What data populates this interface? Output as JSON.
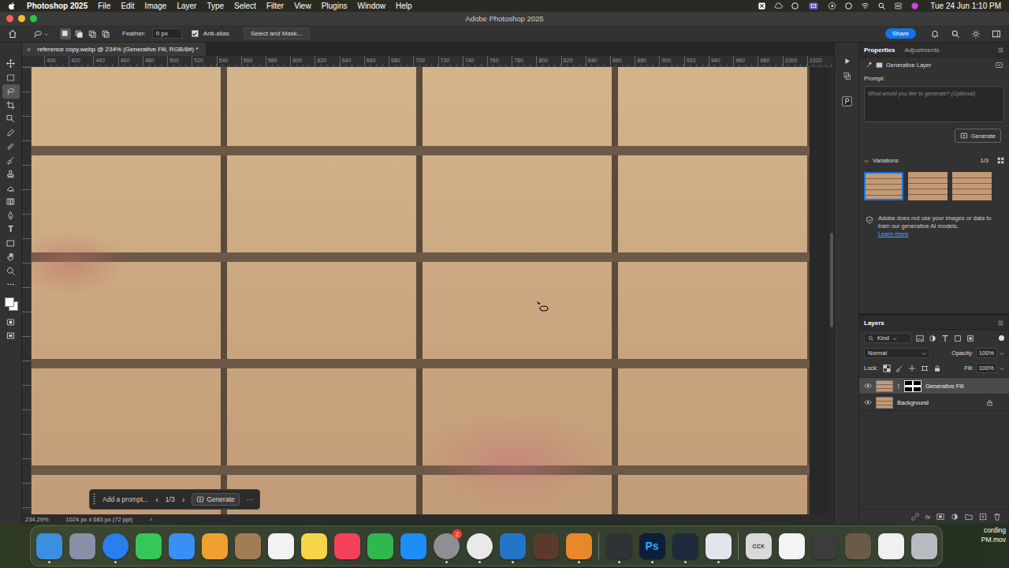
{
  "menubar": {
    "app": "Photoshop 2025",
    "menus": [
      "File",
      "Edit",
      "Image",
      "Layer",
      "Type",
      "Select",
      "Filter",
      "View",
      "Plugins",
      "Window",
      "Help"
    ],
    "clock": "Tue 24 Jun 1:10 PM"
  },
  "window": {
    "title": "Adobe Photoshop 2025"
  },
  "options_bar": {
    "modes": [
      {
        "selected": true
      },
      {
        "selected": false
      },
      {
        "selected": false
      },
      {
        "selected": false
      }
    ],
    "feather_label": "Feather:",
    "feather_value": "0 px",
    "anti_alias": {
      "label": "Anti-alias",
      "checked": true
    },
    "select_mask": "Select and Mask...",
    "share": "Share"
  },
  "tools": [
    {
      "kind": "move",
      "selected": false
    },
    {
      "kind": "marquee",
      "selected": false
    },
    {
      "kind": "lasso",
      "selected": true
    },
    {
      "kind": "crop",
      "selected": false
    },
    {
      "kind": "object",
      "selected": false
    },
    {
      "kind": "eyedropper",
      "selected": false
    },
    {
      "kind": "healing",
      "selected": false
    },
    {
      "kind": "brush",
      "selected": false
    },
    {
      "kind": "stamp",
      "selected": false
    },
    {
      "kind": "eraser",
      "selected": false
    },
    {
      "kind": "gradient",
      "selected": false
    },
    {
      "kind": "pen",
      "selected": false
    },
    {
      "kind": "type",
      "selected": false,
      "glyph": "T"
    },
    {
      "kind": "shape",
      "selected": false
    },
    {
      "kind": "hand",
      "selected": false
    },
    {
      "kind": "zoom",
      "selected": false
    },
    {
      "kind": "more",
      "selected": false
    }
  ],
  "document": {
    "tab_close": "×",
    "tab_title": "reference copy.webp @ 234% (Generative Fill, RGB/8#) *",
    "ruler_ticks": [
      "400",
      "420",
      "440",
      "460",
      "480",
      "500",
      "520",
      "540",
      "560",
      "580",
      "600",
      "620",
      "640",
      "660",
      "680",
      "700",
      "720",
      "740",
      "760",
      "780",
      "800",
      "820",
      "840",
      "860",
      "880",
      "900",
      "920",
      "940",
      "960",
      "980",
      "1000",
      "1020"
    ],
    "zoom": "234.29%",
    "dimensions": "1024 px x 683 px (72 ppi)",
    "status_arrow": "›"
  },
  "taskbar": {
    "prompt_placeholder": "Add a prompt...",
    "prev": "‹",
    "page": "1/3",
    "next": "›",
    "generate": "Generate",
    "more": "···"
  },
  "properties": {
    "tabs": [
      {
        "label": "Properties",
        "selected": true
      },
      {
        "label": "Adjustments",
        "selected": false
      }
    ],
    "layer_type": "Generative Layer",
    "prompt_label": "Prompt:",
    "prompt_placeholder": "What would you like to generate? (Optional)",
    "generate": "Generate",
    "variations": {
      "label": "Variations",
      "expanded": true,
      "page": "1/3",
      "thumbs": [
        {
          "selected": true
        },
        {
          "selected": false
        },
        {
          "selected": false
        }
      ]
    },
    "notice": "Adobe does not use your images or data to train our generative AI models.",
    "learn_more": "Learn more"
  },
  "layers_panel": {
    "title": "Layers",
    "filter": "Kind",
    "blend": "Normal",
    "opacity_label": "Opacity:",
    "opacity": "100%",
    "lock_label": "Lock:",
    "fill_label": "Fill:",
    "fill": "100%",
    "layers": [
      {
        "name": "Generative Fill",
        "kind": "generative",
        "visible": true,
        "selected": true,
        "locked": false
      },
      {
        "name": "Background",
        "kind": "background",
        "visible": true,
        "selected": false,
        "locked": true
      }
    ],
    "fx": "fx"
  },
  "dock": [
    {
      "name": "finder",
      "color": "#3b8fe0",
      "running": true
    },
    {
      "name": "launchpad",
      "color": "#8a8fa8",
      "running": false
    },
    {
      "name": "safari",
      "color": "#2a7ef0",
      "running": true
    },
    {
      "name": "messages",
      "color": "#35c759",
      "running": false
    },
    {
      "name": "mail",
      "color": "#3a8ff5",
      "running": false
    },
    {
      "name": "photos",
      "color": "#f0a030",
      "running": false
    },
    {
      "name": "contacts",
      "color": "#a27c55",
      "running": false
    },
    {
      "name": "reminders",
      "color": "#f2f2f2",
      "running": false
    },
    {
      "name": "notes",
      "color": "#f7d54a",
      "running": false
    },
    {
      "name": "music",
      "color": "#f5405a",
      "running": false
    },
    {
      "name": "numbers",
      "color": "#2fb84f",
      "running": false
    },
    {
      "name": "app-store",
      "color": "#1c8ef5",
      "running": false
    },
    {
      "name": "system-settings",
      "color": "#8e8e93",
      "running": true,
      "badge": "2"
    },
    {
      "name": "chrome",
      "color": "#e9e9e9",
      "running": true
    },
    {
      "name": "vscode",
      "color": "#2474c8",
      "running": true
    },
    {
      "name": "cocktail",
      "color": "#5a3a2a",
      "running": false
    },
    {
      "name": "blender",
      "color": "#e8882a",
      "running": true
    },
    {
      "name": "arrow-app",
      "color": "#2f3336",
      "running": true
    },
    {
      "name": "photoshop",
      "color": "#0b1e3a",
      "running": true,
      "label": "Ps"
    },
    {
      "name": "activity",
      "color": "#1f2a3a",
      "running": true
    },
    {
      "name": "screen-recorder",
      "color": "#e4e4ec",
      "running": true
    },
    {
      "name": "ccx-file",
      "color": "#d9d9d9",
      "running": false,
      "label": "CCX"
    },
    {
      "name": "window-thumb",
      "color": "#f4f4f4",
      "running": false
    },
    {
      "name": "window-thumb",
      "color": "#3c3c3c",
      "running": false
    },
    {
      "name": "window-thumb",
      "color": "#6a5a48",
      "running": false
    },
    {
      "name": "window-thumb",
      "color": "#f0f0f0",
      "running": false
    },
    {
      "name": "trash",
      "color": "#b8bcc2",
      "running": false
    }
  ],
  "desktop_labels": [
    "cording",
    "PM.mov"
  ]
}
